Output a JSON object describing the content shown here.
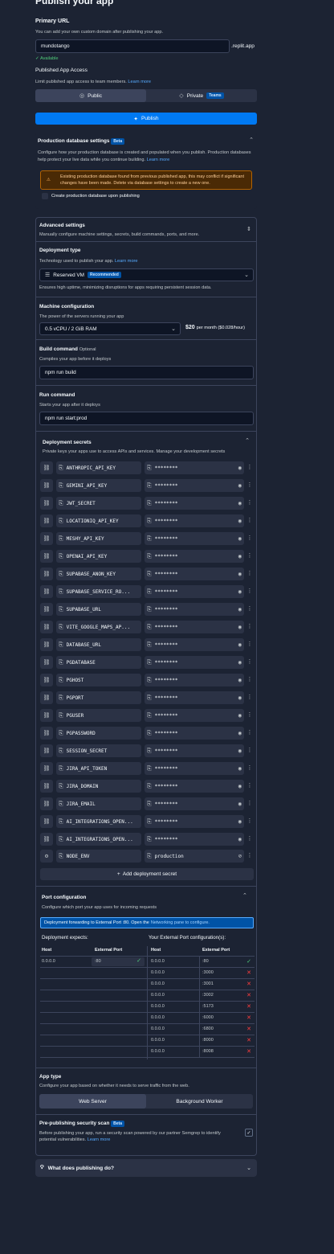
{
  "header": {
    "title": "Publish your app"
  },
  "primary_url": {
    "label": "Primary URL",
    "hint": "You can add your own custom domain after publishing your app.",
    "value": "mundotango",
    "suffix": ".replit.app",
    "status": "Available"
  },
  "access": {
    "label": "Published App Access",
    "hint": "Limit published app access to team members.",
    "learn_more": "Learn more",
    "public_label": "Public",
    "private_label": "Private",
    "teams_badge": "Teams"
  },
  "publish_button": "Publish",
  "prod_db": {
    "title": "Production database settings",
    "badge": "Beta",
    "desc": "Configure how your production database is created and populated when you publish. Production databases help protect your live data while you continue building.",
    "learn_more": "Learn more",
    "warning": "Existing production database found from previous published app, this may conflict if significant changes have been made. Delete via database settings to create a new one.",
    "checkbox_label": "Create production database upon publishing"
  },
  "advanced": {
    "title": "Advanced settings",
    "desc": "Manually configure machine settings, secrets, build commands, ports, and more."
  },
  "deployment_type": {
    "title": "Deployment type",
    "desc": "Technology used to publish your app.",
    "learn_more": "Learn more",
    "value": "Reserved VM",
    "badge": "Recommended",
    "note": "Ensures high uptime, minimizing disruptions for apps requiring persistent session data."
  },
  "machine": {
    "title": "Machine configuration",
    "desc": "The power of the servers running your app",
    "value": "0.5 vCPU / 2 GiB RAM",
    "price": "$20",
    "price_note": "per month ($0.028/hour)"
  },
  "build": {
    "title": "Build command",
    "optional": "Optional",
    "desc": "Compiles your app before it deploys",
    "value": "npm run build"
  },
  "run": {
    "title": "Run command",
    "desc": "Starts your app after it deploys",
    "value": "npm run start:prod"
  },
  "secrets": {
    "title": "Deployment secrets",
    "desc": "Private keys your apps use to access APIs and services. Manage your development secrets",
    "masked": "********",
    "items": [
      {
        "key": "ANTHROPIC_API_KEY"
      },
      {
        "key": "GEMINI_API_KEY"
      },
      {
        "key": "JWT_SECRET"
      },
      {
        "key": "LOCATIONIQ_API_KEY"
      },
      {
        "key": "MESHY_API_KEY"
      },
      {
        "key": "OPENAI_API_KEY"
      },
      {
        "key": "SUPABASE_ANON_KEY"
      },
      {
        "key": "SUPABASE_SERVICE_RO..."
      },
      {
        "key": "SUPABASE_URL"
      },
      {
        "key": "VITE_GOOGLE_MAPS_AP..."
      },
      {
        "key": "DATABASE_URL"
      },
      {
        "key": "PGDATABASE"
      },
      {
        "key": "PGHOST"
      },
      {
        "key": "PGPORT"
      },
      {
        "key": "PGUSER"
      },
      {
        "key": "PGPASSWORD"
      },
      {
        "key": "SESSION_SECRET"
      },
      {
        "key": "JIRA_API_TOKEN"
      },
      {
        "key": "JIRA_DOMAIN"
      },
      {
        "key": "JIRA_EMAIL"
      },
      {
        "key": "AI_INTEGRATIONS_OPEN..."
      },
      {
        "key": "AI_INTEGRATIONS_OPEN..."
      }
    ],
    "env_item": {
      "key": "NODE_ENV",
      "value": "production"
    },
    "add_label": "Add deployment secret"
  },
  "ports": {
    "title": "Port configuration",
    "desc": "Configure which port your app uses for incoming requests",
    "banner": "Deployment forwarding to External Port :80. Open the",
    "banner_link": "Networking pane to configure.",
    "left_title": "Deployment expects:",
    "right_title": "Your External Port configuration(s):",
    "col_host": "Host",
    "col_external": "External Port",
    "expected": {
      "host": "0.0.0.0",
      "port": ":80"
    },
    "configured": [
      {
        "host": "0.0.0.0",
        "port": ":80",
        "ok": true
      },
      {
        "host": "0.0.0.0",
        "port": ":3000",
        "ok": false
      },
      {
        "host": "0.0.0.0",
        "port": ":3001",
        "ok": false
      },
      {
        "host": "0.0.0.0",
        "port": ":3002",
        "ok": false
      },
      {
        "host": "0.0.0.0",
        "port": ":5173",
        "ok": false
      },
      {
        "host": "0.0.0.0",
        "port": ":6000",
        "ok": false
      },
      {
        "host": "0.0.0.0",
        "port": ":6800",
        "ok": false
      },
      {
        "host": "0.0.0.0",
        "port": ":8000",
        "ok": false
      },
      {
        "host": "0.0.0.0",
        "port": ":8008",
        "ok": false
      }
    ]
  },
  "app_type": {
    "title": "App type",
    "desc": "Configure your app based on whether it needs to serve traffic from the web.",
    "web_server": "Web Server",
    "background_worker": "Background Worker"
  },
  "scan": {
    "title": "Pre-publishing security scan",
    "badge": "Beta",
    "desc": "Before publishing your app, run a security scan powered by our partner Semgrep to identify potential vulnerabilities.",
    "learn_more": "Learn more"
  },
  "faq": {
    "label": "What does publishing do?"
  }
}
